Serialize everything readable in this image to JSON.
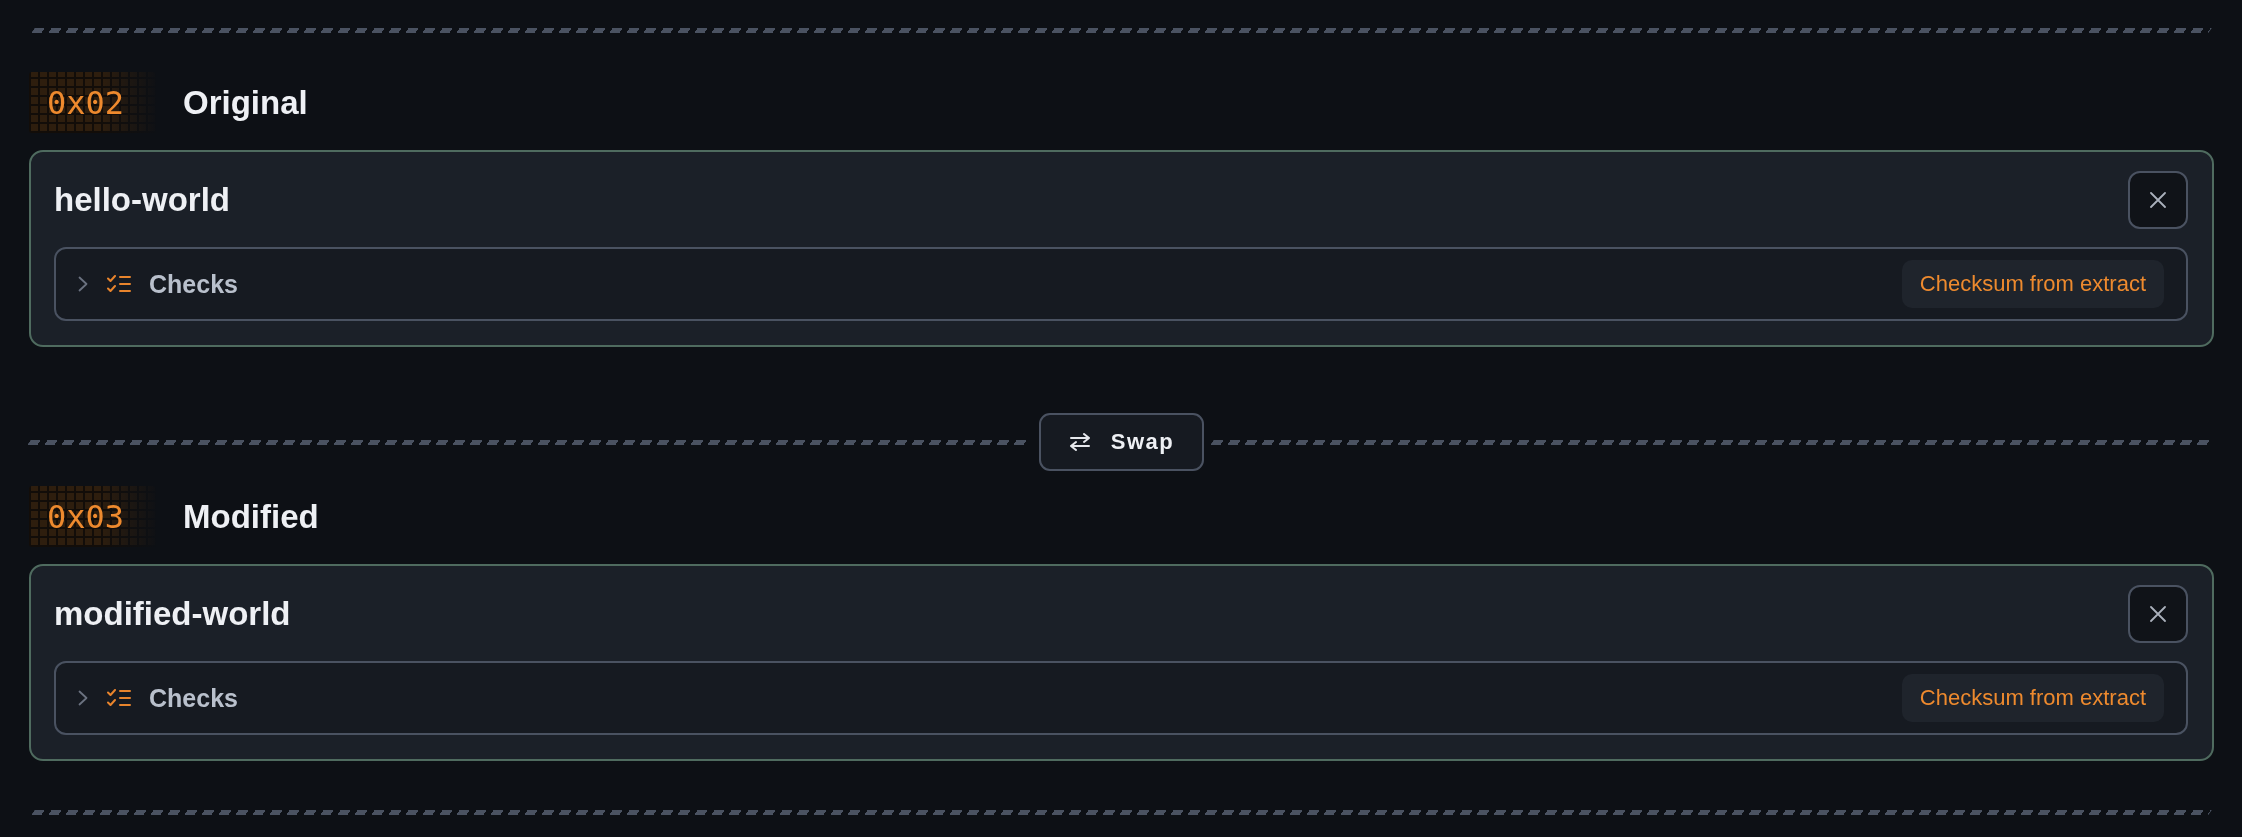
{
  "blocks": [
    {
      "kind": "section",
      "index": "0x02",
      "title": "Original",
      "card": {
        "name": "hello-world",
        "checks": {
          "label": "Checks",
          "expanded": false,
          "action": "Checksum from extract"
        }
      }
    },
    {
      "kind": "swap",
      "label": "Swap"
    },
    {
      "kind": "section",
      "index": "0x03",
      "title": "Modified",
      "card": {
        "name": "modified-world",
        "checks": {
          "label": "Checks",
          "expanded": false,
          "action": "Checksum from extract"
        }
      }
    }
  ]
}
